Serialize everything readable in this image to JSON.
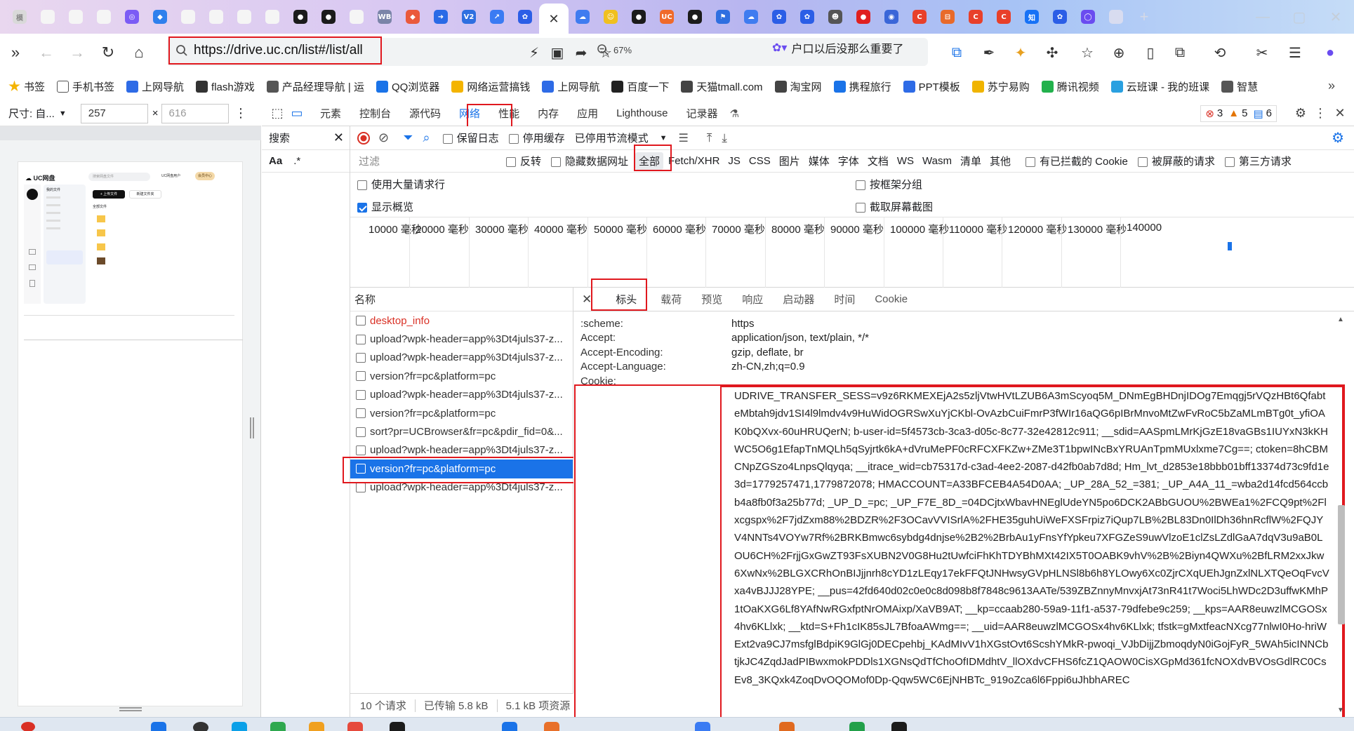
{
  "tabs": {
    "items": [
      {
        "icon": "tab-favicon-text",
        "color": "#d9d9d9",
        "glyph": "模"
      },
      {
        "icon": "tab-favicon-blank",
        "color": "#f5f5f5",
        "glyph": ""
      },
      {
        "icon": "tab-favicon-blank",
        "color": "#f5f5f5",
        "glyph": ""
      },
      {
        "icon": "tab-favicon-blank",
        "color": "#f5f5f5",
        "glyph": ""
      },
      {
        "icon": "tab-favicon-purple",
        "color": "#7b5cf5",
        "glyph": "◎"
      },
      {
        "icon": "tab-favicon-bird",
        "color": "#2f80ed",
        "glyph": "◆"
      },
      {
        "icon": "tab-favicon-blank",
        "color": "#f5f5f5",
        "glyph": ""
      },
      {
        "icon": "tab-favicon-blank",
        "color": "#f5f5f5",
        "glyph": ""
      },
      {
        "icon": "tab-favicon-blank",
        "color": "#f5f5f5",
        "glyph": ""
      },
      {
        "icon": "tab-favicon-blank",
        "color": "#f5f5f5",
        "glyph": ""
      },
      {
        "icon": "tab-favicon-qq",
        "color": "#1b1b1b",
        "glyph": "●"
      },
      {
        "icon": "tab-favicon-qq",
        "color": "#1b1b1b",
        "glyph": "●"
      },
      {
        "icon": "tab-favicon-doc",
        "color": "#f5f5f5",
        "glyph": ""
      },
      {
        "icon": "tab-favicon-wb",
        "color": "#7a84a8",
        "glyph": "WB"
      },
      {
        "icon": "tab-favicon-multi",
        "color": "#ea5a3c",
        "glyph": "◆"
      },
      {
        "icon": "tab-favicon-arrow",
        "color": "#2a6ae6",
        "glyph": "➜"
      },
      {
        "icon": "tab-favicon-v2",
        "color": "#2f6fe0",
        "glyph": "V2"
      },
      {
        "icon": "tab-favicon-chart",
        "color": "#3a7bf3",
        "glyph": "↗"
      },
      {
        "icon": "tab-favicon-baidu",
        "color": "#2b5ee6",
        "glyph": "✿"
      }
    ],
    "active_close": "✕",
    "after_items": [
      {
        "icon": "tab-favicon-cloud",
        "color": "#3f7cf0",
        "glyph": "☁"
      },
      {
        "icon": "tab-favicon-face",
        "color": "#f0c020",
        "glyph": "☺"
      },
      {
        "icon": "tab-favicon-ball",
        "color": "#1b1b1b",
        "glyph": "●"
      },
      {
        "icon": "tab-favicon-uc",
        "color": "#f06a2a",
        "glyph": "UC"
      },
      {
        "icon": "tab-favicon-ball",
        "color": "#1b1b1b",
        "glyph": "●"
      },
      {
        "icon": "tab-favicon-flag",
        "color": "#2f6fe0",
        "glyph": "⚑"
      },
      {
        "icon": "tab-favicon-cloud",
        "color": "#3f7cf0",
        "glyph": "☁"
      },
      {
        "icon": "tab-favicon-baidu",
        "color": "#2b5ee6",
        "glyph": "✿"
      },
      {
        "icon": "tab-favicon-baidu",
        "color": "#2b5ee6",
        "glyph": "✿"
      },
      {
        "icon": "tab-favicon-mascot",
        "color": "#555555",
        "glyph": "☻"
      },
      {
        "icon": "tab-favicon-red",
        "color": "#e02020",
        "glyph": "●"
      },
      {
        "icon": "tab-favicon-blue-c",
        "color": "#3a66d8",
        "glyph": "◉"
      },
      {
        "icon": "tab-favicon-c",
        "color": "#e8402a",
        "glyph": "C"
      },
      {
        "icon": "tab-favicon-orange",
        "color": "#e86a2a",
        "glyph": "⊟"
      },
      {
        "icon": "tab-favicon-c",
        "color": "#e8402a",
        "glyph": "C"
      },
      {
        "icon": "tab-favicon-c",
        "color": "#e8402a",
        "glyph": "C"
      },
      {
        "icon": "tab-favicon-zhihu",
        "color": "#1772f6",
        "glyph": "知"
      },
      {
        "icon": "tab-favicon-baidu",
        "color": "#2b5ee6",
        "glyph": "✿"
      },
      {
        "icon": "tab-favicon-circle",
        "color": "#6a4cf0",
        "glyph": "◯"
      },
      {
        "icon": "tab-favicon-faded",
        "color": "#d8dcf0",
        "glyph": ""
      }
    ],
    "new_tab": "+"
  },
  "window": {
    "minimize": "—",
    "maximize": "▢",
    "close": "✕"
  },
  "address": {
    "url": "https://drive.uc.cn/list#/list/all",
    "zoom": "67%",
    "news_text": "户口以后没那么重要了"
  },
  "bookmarks": [
    {
      "label": "书签",
      "color": "#f4b400"
    },
    {
      "label": "手机书签",
      "color": "#ffffff"
    },
    {
      "label": "上网导航",
      "color": "#2e6be6"
    },
    {
      "label": "flash游戏",
      "color": "#333333"
    },
    {
      "label": "产品经理导航 | 运",
      "color": "#555555"
    },
    {
      "label": "QQ浏览器",
      "color": "#1a73e8"
    },
    {
      "label": "网络运营搞钱",
      "color": "#f4b400"
    },
    {
      "label": "上网导航",
      "color": "#2e6be6"
    },
    {
      "label": "百度一下",
      "color": "#222222"
    },
    {
      "label": "天猫tmall.com",
      "color": "#444444"
    },
    {
      "label": "淘宝网",
      "color": "#444444"
    },
    {
      "label": "携程旅行",
      "color": "#1a73e8"
    },
    {
      "label": "PPT模板",
      "color": "#2e6be6"
    },
    {
      "label": "苏宁易购",
      "color": "#f0b400"
    },
    {
      "label": "腾讯视频",
      "color": "#22b14c"
    },
    {
      "label": "云班课 - 我的班课",
      "color": "#2aa0e0"
    },
    {
      "label": "智慧",
      "color": "#555555"
    }
  ],
  "device_toolbar": {
    "size_label": "尺寸: 自...",
    "width": "257",
    "times": "×",
    "height": "616"
  },
  "devtools": {
    "tabs": [
      "元素",
      "控制台",
      "源代码",
      "网络",
      "性能",
      "内存",
      "应用",
      "Lighthouse",
      "记录器"
    ],
    "selected_tab": "网络",
    "error_count": "3",
    "warn_count": "5",
    "msg_count": "6",
    "search_label": "搜索",
    "search_aa": "Aa",
    "search_regex": ".*",
    "preserve_log": "保留日志",
    "disable_cache": "停用缓存",
    "throttle": "已停用节流模式",
    "filter_placeholder": "过滤",
    "invert": "反转",
    "hide_data_url": "隐藏数据网址",
    "filter_types": [
      "全部",
      "Fetch/XHR",
      "JS",
      "CSS",
      "图片",
      "媒体",
      "字体",
      "文档",
      "WS",
      "Wasm",
      "清单",
      "其他"
    ],
    "blocked_cookies": "有已拦截的 Cookie",
    "blocked_requests": "被屏蔽的请求",
    "third_party": "第三方请求",
    "big_rows": "使用大量请求行",
    "group_by_frame": "按框架分组",
    "show_overview": "显示概览",
    "capture_screenshots": "截取屏幕截图"
  },
  "timeline_ticks": [
    "10000 毫秒",
    "20000 毫秒",
    "30000 毫秒",
    "40000 毫秒",
    "50000 毫秒",
    "60000 毫秒",
    "70000 毫秒",
    "80000 毫秒",
    "90000 毫秒",
    "100000 毫秒",
    "110000 毫秒",
    "120000 毫秒",
    "130000 毫秒",
    "140000"
  ],
  "requests": {
    "header": "名称",
    "items": [
      {
        "name": "desktop_info",
        "state": "error"
      },
      {
        "name": "upload?wpk-header=app%3Dt4juls37-z...",
        "state": ""
      },
      {
        "name": "upload?wpk-header=app%3Dt4juls37-z...",
        "state": ""
      },
      {
        "name": "version?fr=pc&platform=pc",
        "state": ""
      },
      {
        "name": "upload?wpk-header=app%3Dt4juls37-z...",
        "state": ""
      },
      {
        "name": "version?fr=pc&platform=pc",
        "state": ""
      },
      {
        "name": "sort?pr=UCBrowser&fr=pc&pdir_fid=0&...",
        "state": ""
      },
      {
        "name": "upload?wpk-header=app%3Dt4juls37-z...",
        "state": ""
      },
      {
        "name": "version?fr=pc&platform=pc",
        "state": "selected"
      },
      {
        "name": "upload?wpk-header=app%3Dt4juls37-z...",
        "state": ""
      }
    ],
    "count": "10 个请求",
    "transferred": "已传输 5.8 kB",
    "resources": "5.1 kB 项资源"
  },
  "detail": {
    "close": "✕",
    "tabs": [
      "标头",
      "载荷",
      "预览",
      "响应",
      "启动器",
      "时间",
      "Cookie"
    ],
    "headers": [
      {
        "k": ":scheme:",
        "v": "https"
      },
      {
        "k": "Accept:",
        "v": "application/json, text/plain, */*"
      },
      {
        "k": "Accept-Encoding:",
        "v": "gzip, deflate, br"
      },
      {
        "k": "Accept-Language:",
        "v": "zh-CN,zh;q=0.9"
      },
      {
        "k": "Cookie:",
        "v": ""
      }
    ],
    "cookie_value": "UDRIVE_TRANSFER_SESS=v9z6RKMEXEjA2s5zljVtwHVtLZUB6A3mScyoq5M_DNmEgBHDnjIDOg7Emqgj5rVQzHBt6QfabteMbtah9jdv1SI4l9lmdv4v9HuWidOGRSwXuYjCKbl-OvAzbCuiFmrP3fWIr16aQG6pIBrMnvoMtZwFvRoC5bZaMLmBTg0t_yfiOAK0bQXvx-60uHRUQerN; b-user-id=5f4573cb-3ca3-d05c-8c77-32e42812c911; __sdid=AASpmLMrKjGzE18vaGBs1IUYxN3kKHWC5O6g1EfapTnMQLh5qSyjrtk6kA+dVruMePF0cRFCXFKZw+ZMe3T1bpwINcBxYRUAnTpmMUxlxme7Cg==; ctoken=8hCBMCNpZGSzo4LnpsQlqyqa; __itrace_wid=cb75317d-c3ad-4ee2-2087-d42fb0ab7d8d; Hm_lvt_d2853e18bbb01bff13374d73c9fd1e3d=1779257471,1779872078; HMACCOUNT=A33BFCEB4A54D0AA; _UP_28A_52_=381; _UP_A4A_11_=wba2d14fcd564ccbb4a8fb0f3a25b77d; _UP_D_=pc; _UP_F7E_8D_=04DCjtxWbavHNEglUdeYN5po6DCK2ABbGUOU%2BWEa1%2FCQ9pt%2Flxcgspx%2F7jdZxm88%2BDZR%2F3OCavVVISrlA%2FHE35guhUiWeFXSFrpiz7iQup7LB%2BL83Dn0IlDh36hnRcflW%2FQJYV4NNTs4VOYw7Rf%2BRKBmwc6sybdg4dnjse%2B2%2BrbAu1yFnsYfYpkeu7XFGZeS9uwVlzoE1clZsLZdlGaA7dqV3u9aB0LOU6CH%2FrjjGxGwZT93FsXUBN2V0G8Hu2tUwfciFhKhTDYBhMXt42IX5T0OABK9vhV%2B%2Biyn4QWXu%2BfLRM2xxJkw6XwNx%2BLGXCRhOnBIJjjnrh8cYD1zLEqy17ekFFQtJNHwsyGVpHLNSl8b6h8YLOwy6Xc0ZjrCXqUEhJgnZxlNLXTQeOqFvcVxa4vBJJJ28YPE; __pus=42fd640d02c0e0c8d098b8f7848c9613AATe/539ZBZnnyMnvxjAt73nR41t7Woci5LhWDc2D3uffwKMhP1tOaKXG6Lf8YAfNwRGxfptNrOMAixp/XaVB9AT; __kp=ccaab280-59a9-11f1-a537-79dfebe9c259; __kps=AAR8euwzlMCGOSx4hv6KLlxk; __ktd=S+Fh1cIK85sJL7BfoaAWmg==; __uid=AAR8euwzlMCGOSx4hv6KLlxk; tfstk=gMxtfeacNXcg77nlwI0Ho-hriWExt2va9CJ7msfglBdpiK9GlGj0DECpehbj_KAdMIvV1hXGstOvt6ScshYMkR-pwoqi_VJbDijjZbmoqdyN0iGojFyR_5WAh5icINNCbtjkJC4ZqdJadPIBwxmokPDDls1XGNsQdTfChoOfIDMdhtV_llOXdvCFHS6fcZ1QAOW0CisXGpMd361fcNOXdvBVOsGdlRC0CsEv8_3KQxk4ZoqDvOQOMof0Dp-Qqw5WC6EjNHBTc_919oZca6l6Fppi6uJhbhAREC"
  },
  "preview": {
    "logo": "UC网盘",
    "search_hint": "搜索网盘文件",
    "user": "UC网盘用户",
    "vip": "会员中心",
    "upload": "+ 上传文件",
    "new_folder": "新建文件夹",
    "my_files": "我的文件",
    "all_files": "全部文件"
  }
}
